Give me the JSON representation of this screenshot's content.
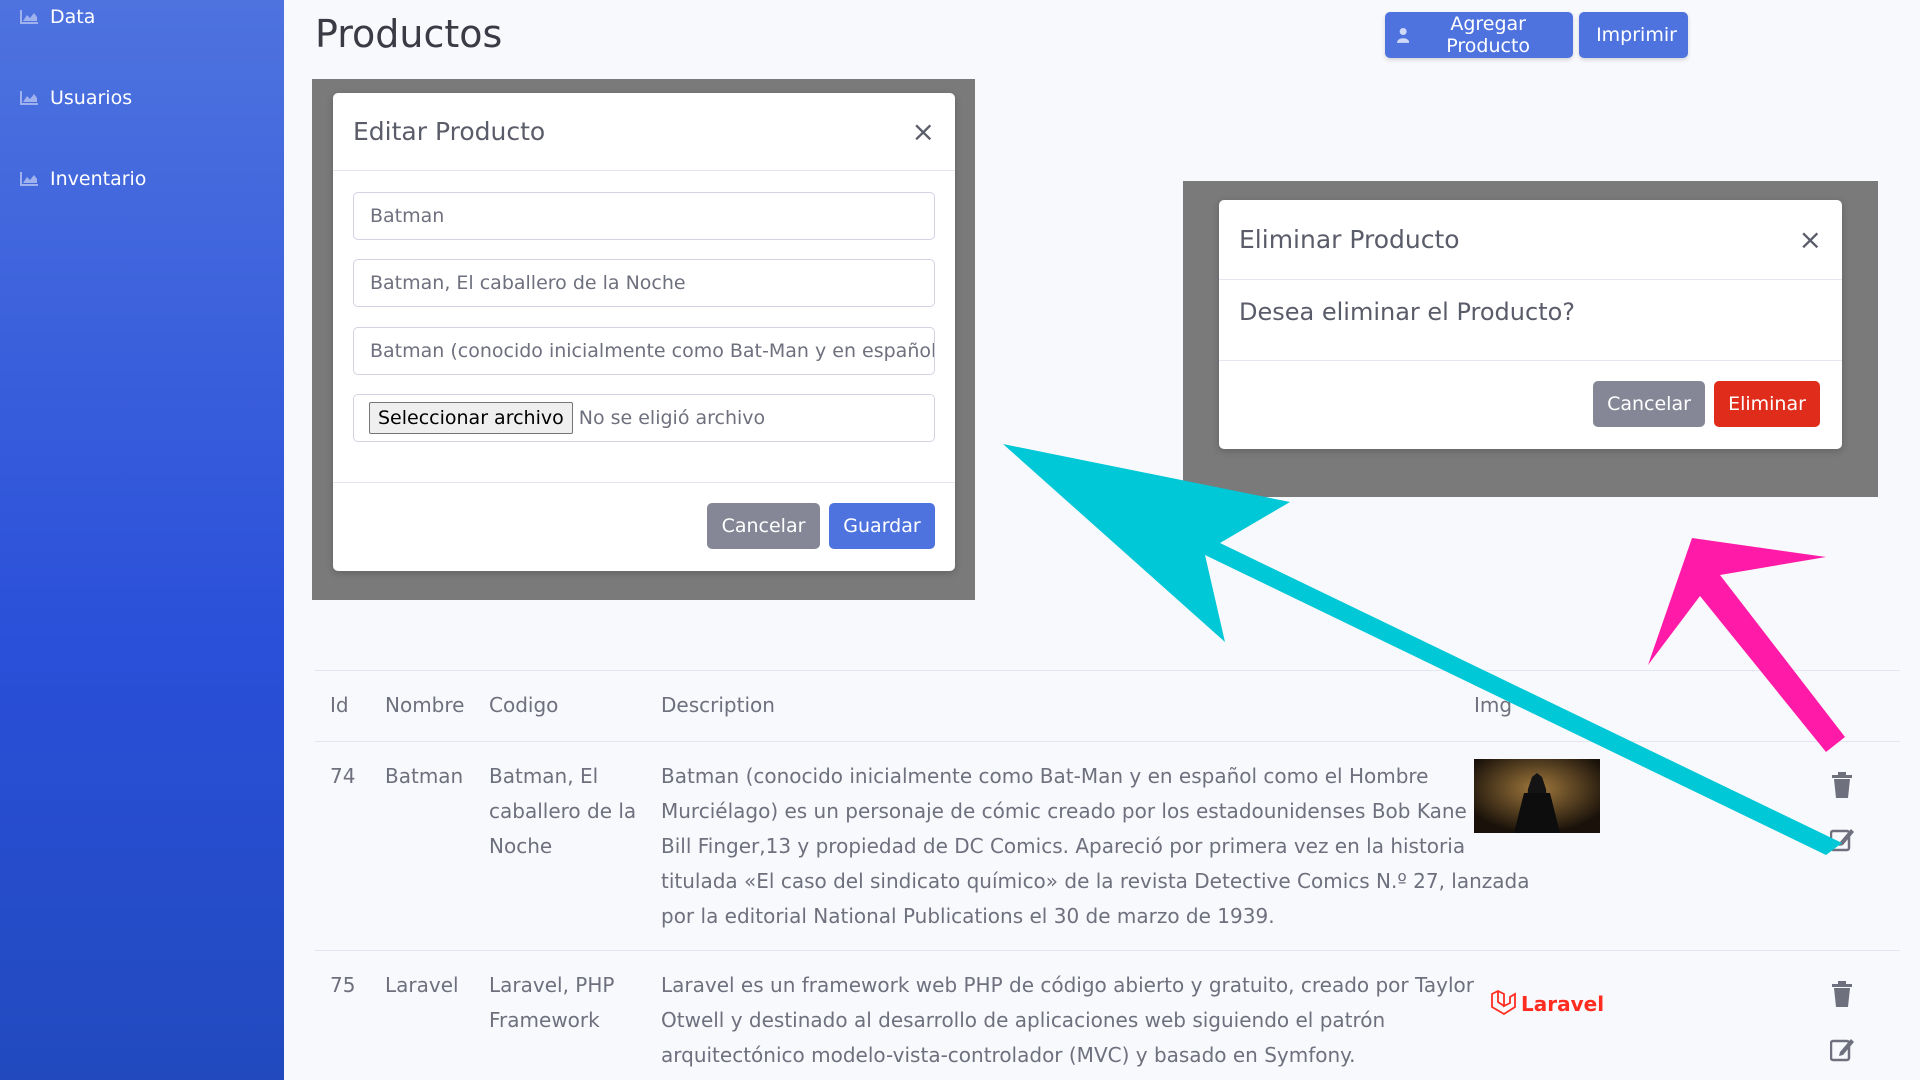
{
  "sidebar": {
    "items": [
      {
        "label": "Data",
        "icon": "chart-area-icon"
      },
      {
        "label": "Usuarios",
        "icon": "chart-area-icon"
      },
      {
        "label": "Inventario",
        "icon": "chart-area-icon"
      }
    ]
  },
  "header": {
    "title": "Productos",
    "add_button": "Agregar Producto",
    "add_icon": "user-icon",
    "print_button": "Imprimir",
    "print_icon": "printer-icon"
  },
  "edit_modal": {
    "title": "Editar Producto",
    "close": "×",
    "field_name": "Batman",
    "field_code": "Batman, El caballero de la Noche",
    "field_description": "Batman (conocido inicialmente como Bat-Man y en español cc",
    "file_button": "Seleccionar archivo",
    "file_status": "No se eligió archivo",
    "cancel": "Cancelar",
    "save": "Guardar"
  },
  "delete_modal": {
    "title": "Eliminar Producto",
    "close": "×",
    "message": "Desea eliminar el Producto?",
    "cancel": "Cancelar",
    "confirm": "Eliminar"
  },
  "table": {
    "headers": {
      "id": "Id",
      "name": "Nombre",
      "code": "Codigo",
      "description": "Description",
      "img": "Img"
    },
    "rows": [
      {
        "id": "74",
        "name": "Batman",
        "code_lines": [
          "Batman, El",
          "caballero de la",
          "Noche"
        ],
        "description_lines": [
          "Batman (conocido inicialmente como Bat-Man y en español como el Hombre",
          "Murciélago) es un personaje de cómic creado por los estadounidenses Bob Kane y",
          "Bill Finger,13 y propiedad de DC Comics. Apareció por primera vez en la historia",
          "titulada «El caso del sindicato químico» de la revista Detective Comics N.º 27, lanzada",
          "por la editorial National Publications el 30 de marzo de 1939."
        ]
      },
      {
        "id": "75",
        "name": "Laravel",
        "code_lines": [
          "Laravel, PHP",
          "Framework"
        ],
        "description_lines": [
          "Laravel es un framework web PHP de código abierto y gratuito, creado por Taylor",
          "Otwell y destinado al desarrollo de aplicaciones web siguiendo el patrón",
          "arquitectónico modelo-vista-controlador (MVC) y basado en Symfony."
        ],
        "logo_text": "Laravel"
      }
    ]
  },
  "colors": {
    "sidebar": "#4e73df",
    "primary": "#4e73df",
    "secondary": "#858796",
    "danger": "#e02d1b",
    "arrow_cyan": "#00c8d7",
    "arrow_magenta": "#ff1aa8",
    "laravel": "#ff2d20"
  }
}
